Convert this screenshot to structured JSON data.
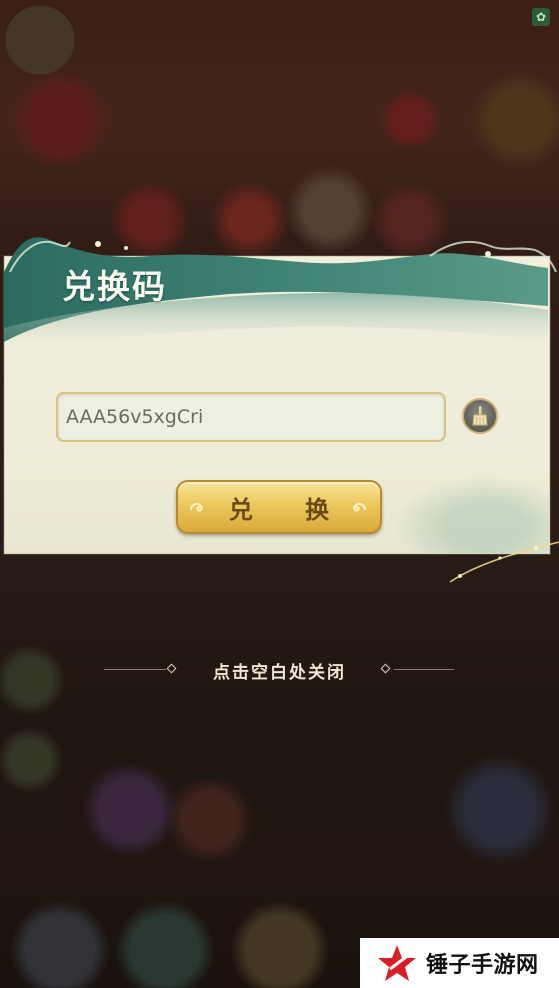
{
  "dialog": {
    "title": "兑换码",
    "code_input": {
      "value": "AAA56v5xgCri",
      "placeholder": ""
    },
    "clear_icon": "broom-icon",
    "redeem_label": "兑 换"
  },
  "close_hint": "点击空白处关闭",
  "watermark": {
    "text": "锤子手游网",
    "logo_icon": "star-logo-icon"
  },
  "colors": {
    "panel": "#efecd9",
    "header_teal": "#2f6e63",
    "button_gold": "#edc85e",
    "button_text": "#6b4a1a"
  }
}
